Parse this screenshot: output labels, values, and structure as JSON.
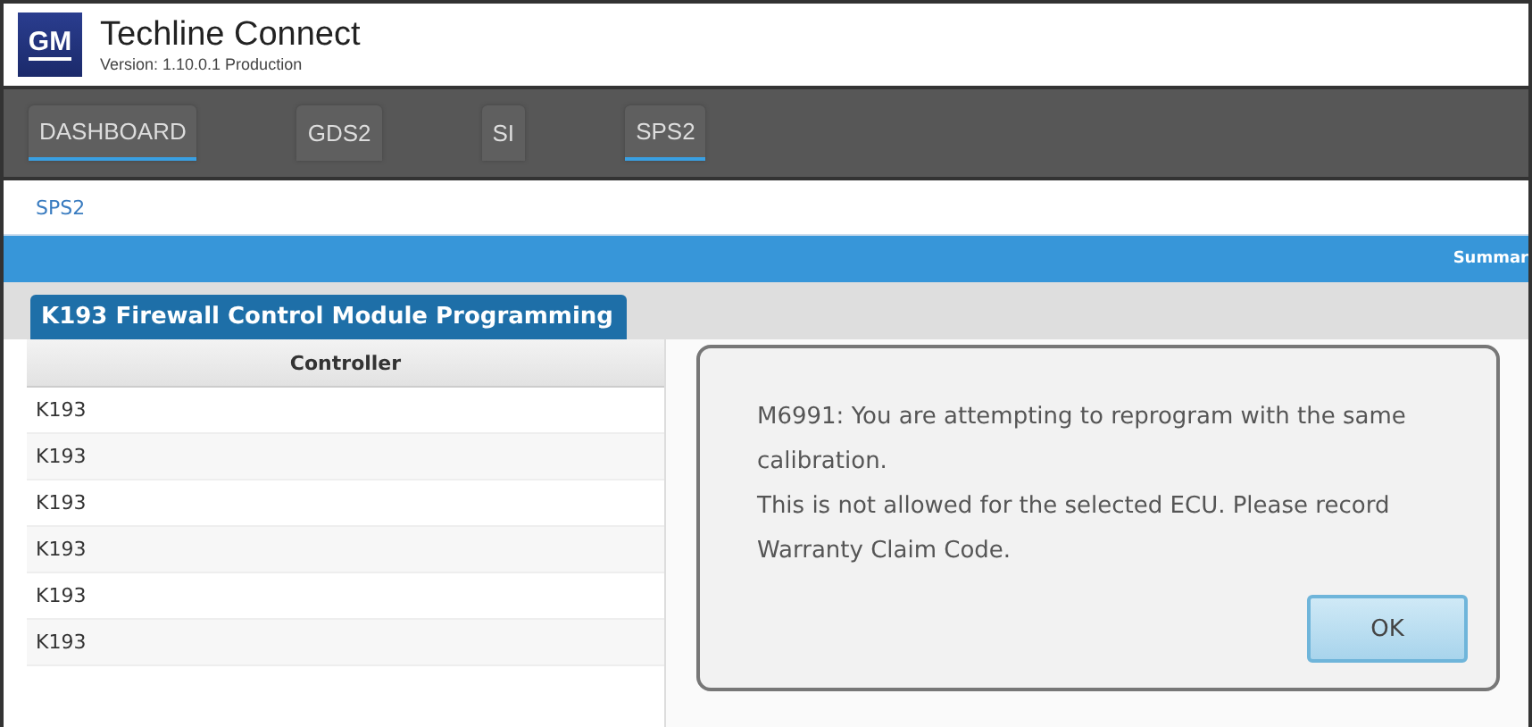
{
  "app": {
    "logo": "GM",
    "title": "Techline Connect",
    "version": "Version: 1.10.0.1 Production"
  },
  "nav_tabs": [
    {
      "label": "DASHBOARD",
      "selected": true
    },
    {
      "label": "GDS2",
      "selected": false
    },
    {
      "label": "SI",
      "selected": false
    },
    {
      "label": "SPS2",
      "selected": true
    }
  ],
  "breadcrumb": "SPS2",
  "banner": {
    "right_text": "Summar"
  },
  "panel": {
    "title": "K193 Firewall Control Module Programming",
    "columns": [
      "Controller"
    ],
    "rows": [
      [
        "K193"
      ],
      [
        "K193"
      ],
      [
        "K193"
      ],
      [
        "K193"
      ],
      [
        "K193"
      ],
      [
        "K193"
      ]
    ]
  },
  "dialog": {
    "message": [
      "M6991: You are attempting to reprogram with the same calibration.",
      "This is not allowed for the selected ECU. Please record Warranty Claim Code."
    ],
    "button": "OK"
  }
}
